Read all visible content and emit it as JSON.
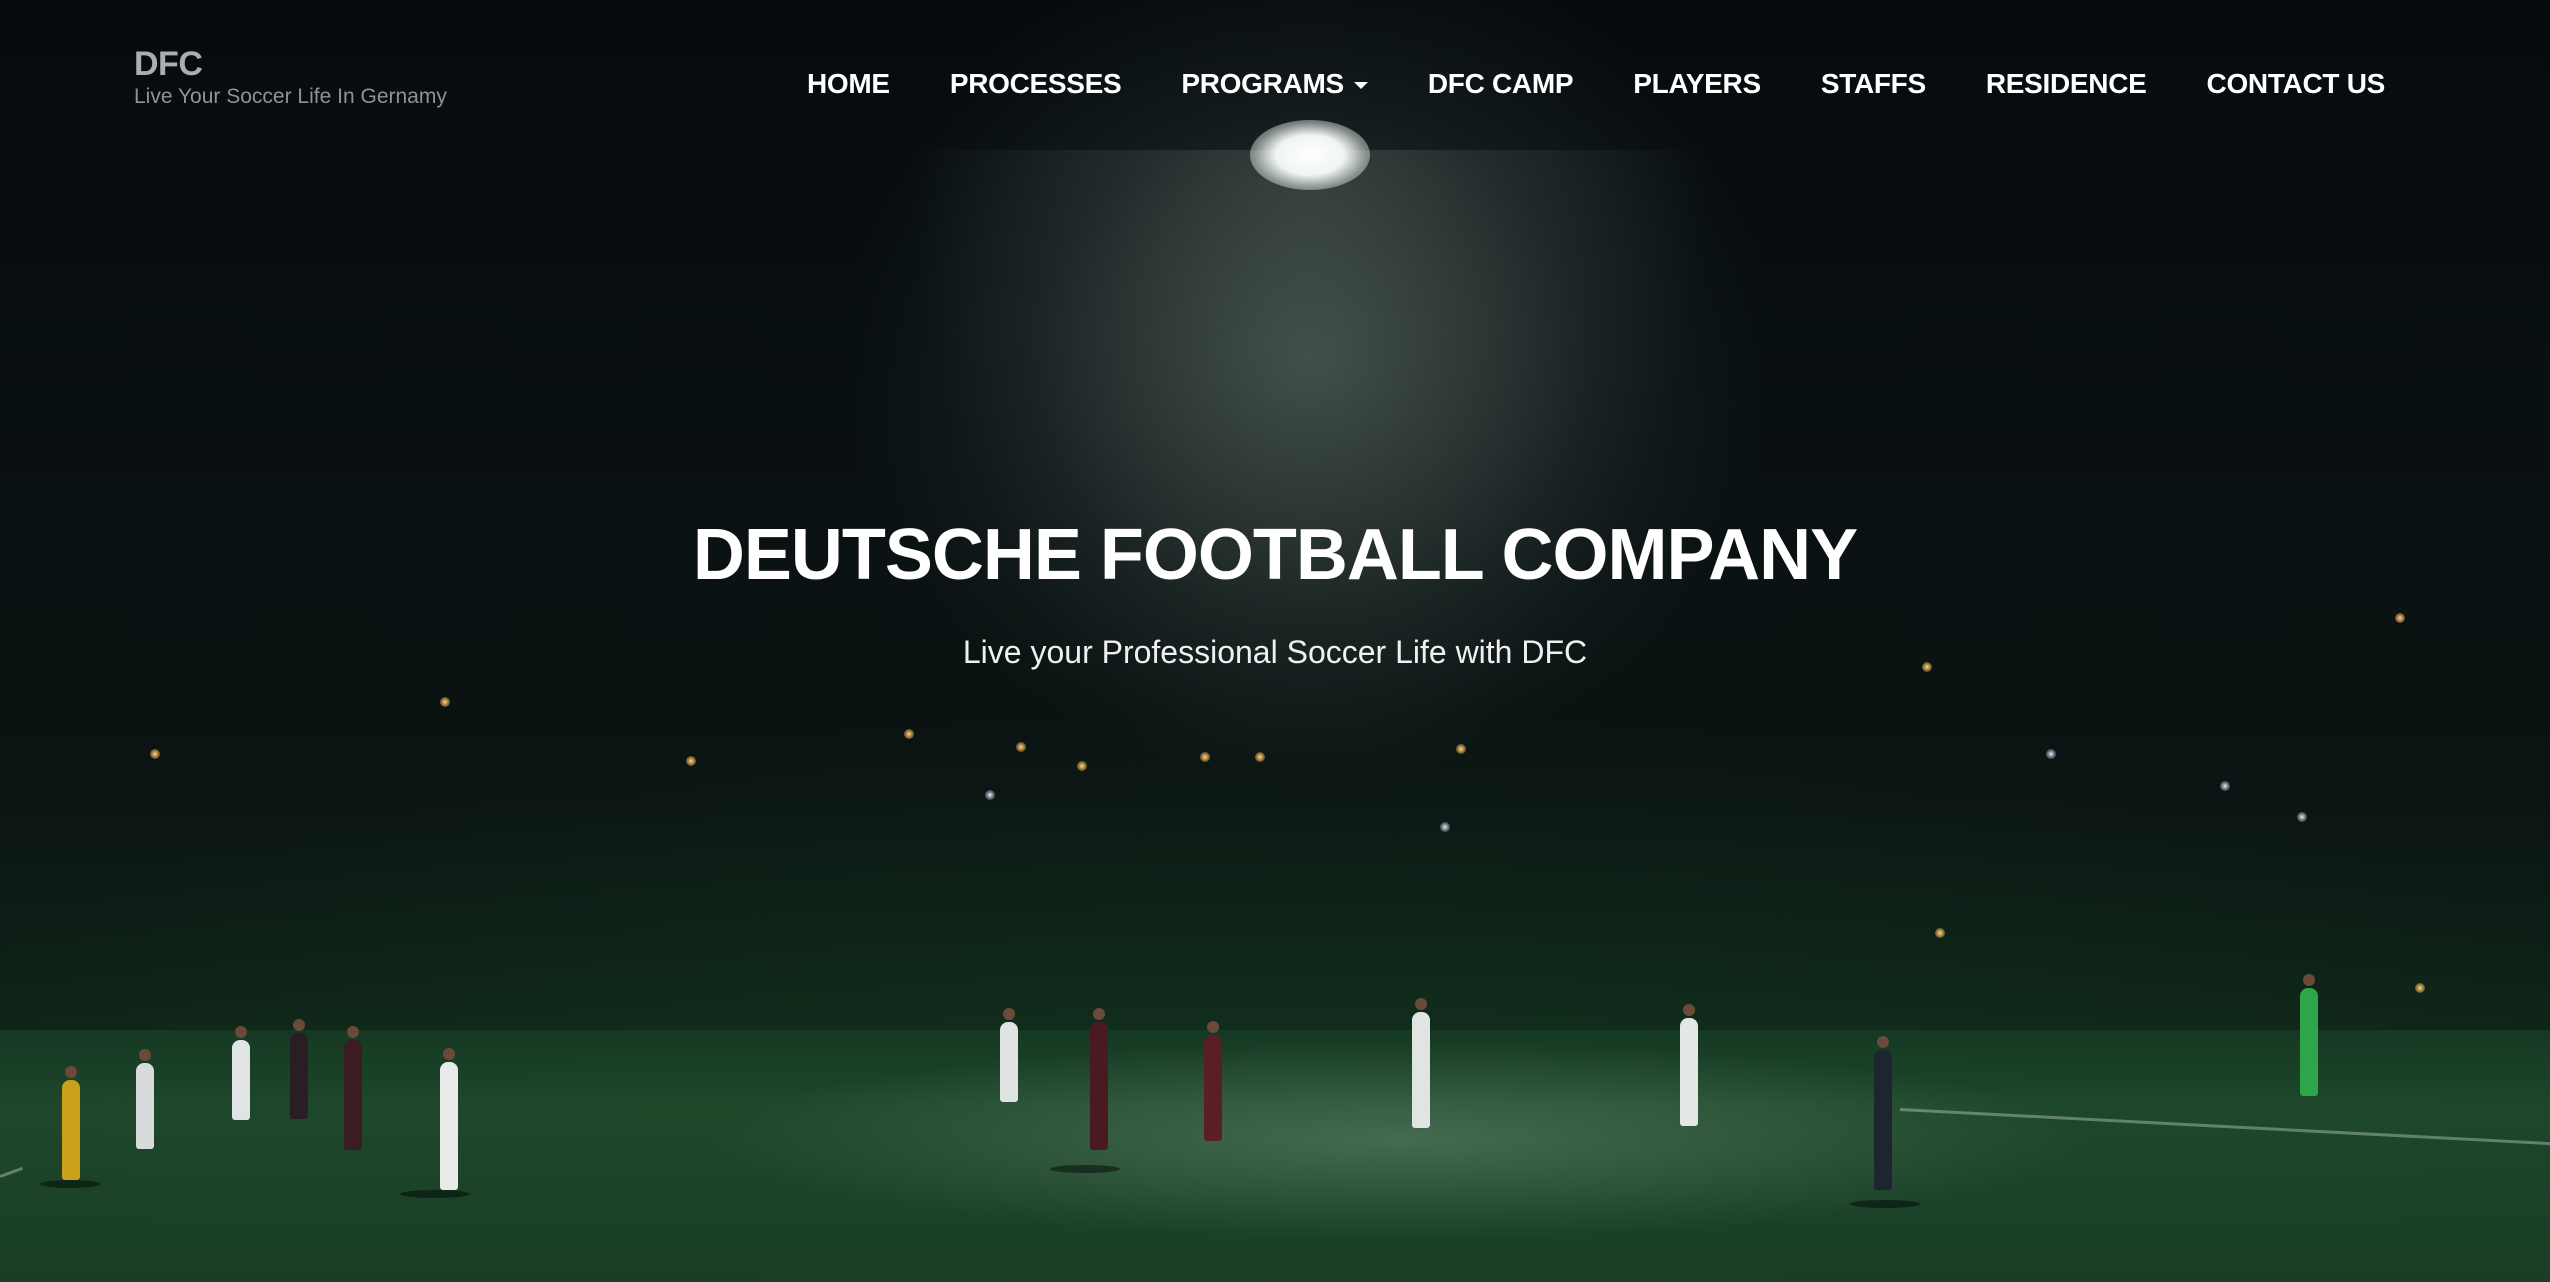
{
  "brand": {
    "name": "DFC",
    "tagline": "Live Your Soccer Life In Gernamy"
  },
  "nav": {
    "items": [
      {
        "label": "HOME"
      },
      {
        "label": "PROCESSES"
      },
      {
        "label": "PROGRAMS",
        "has_dropdown": true
      },
      {
        "label": "DFC CAMP"
      },
      {
        "label": "PLAYERS"
      },
      {
        "label": "STAFFS"
      },
      {
        "label": "RESIDENCE"
      },
      {
        "label": "CONTACT US"
      }
    ]
  },
  "hero": {
    "title": "DEUTSCHE FOOTBALL COMPANY",
    "subtitle": "Live your Professional Soccer Life with DFC"
  },
  "colors": {
    "background": "#05090b",
    "nav_text": "#ffffff",
    "brand_text": "#a9aeb0",
    "pitch": "#1f4a2c"
  }
}
